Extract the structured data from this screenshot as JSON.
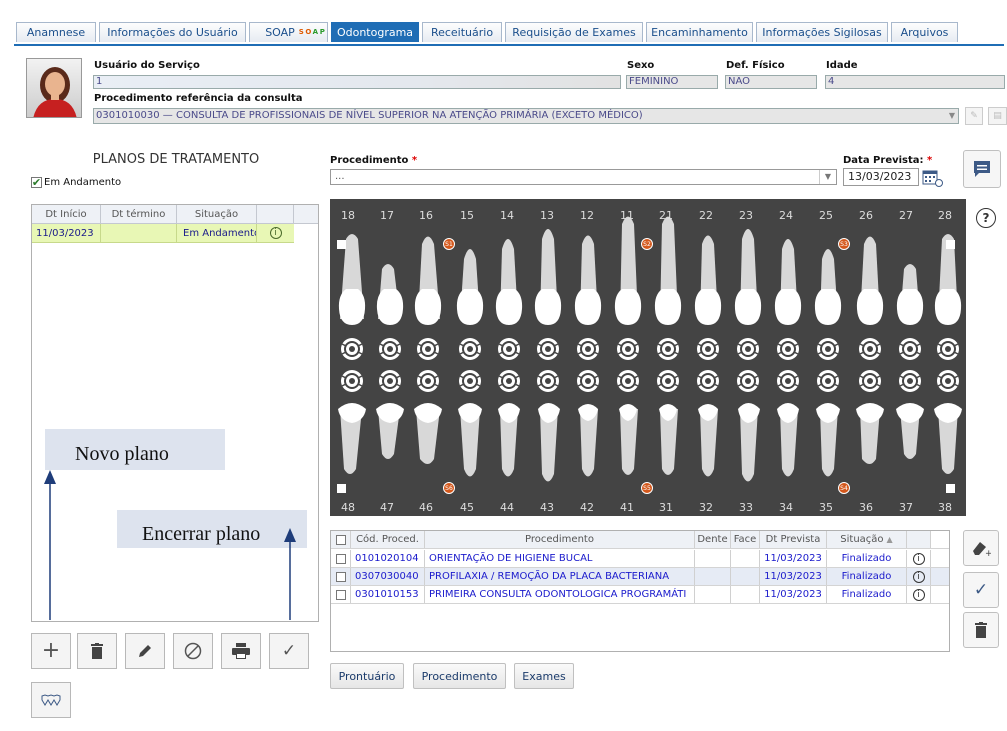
{
  "tabs": [
    {
      "label": "Anamnese"
    },
    {
      "label": "Informações do Usuário"
    },
    {
      "label": "SOAP"
    },
    {
      "label": "Odontograma"
    },
    {
      "label": "Receituário"
    },
    {
      "label": "Requisição de Exames"
    },
    {
      "label": "Encaminhamento"
    },
    {
      "label": "Informações Sigilosas"
    },
    {
      "label": "Arquivos"
    }
  ],
  "soap_badge": {
    "s": "S",
    "o": "O",
    "a": "A",
    "p": "P"
  },
  "patient": {
    "usuario_label": "Usuário do Serviço",
    "usuario_value": "1",
    "sexo_label": "Sexo",
    "sexo_value": "FEMININO",
    "deficiencia_label": "Def. Físico",
    "deficiencia_value": "NÃO",
    "idade_label": "Idade",
    "idade_value": "4",
    "procref_label": "Procedimento referência da consulta",
    "procref_value": "0301010030 — CONSULTA DE PROFISSIONAIS DE NÍVEL SUPERIOR NA ATENÇÃO PRIMÁRIA (EXCETO MÉDICO)"
  },
  "plans": {
    "title": "PLANOS DE TRATAMENTO",
    "filter_label": "Em Andamento",
    "columns": [
      "Dt Início",
      "Dt término",
      "Situação"
    ],
    "rows": [
      {
        "inicio": "11/03/2023",
        "termino": "",
        "situacao": "Em Andamento"
      }
    ]
  },
  "annotations": {
    "novo_plano": "Novo plano",
    "encerrar_plano": "Encerrar plano"
  },
  "procedure": {
    "label": "Procedimento",
    "required": "*",
    "value": "...",
    "date_label": "Data Prevista:",
    "date_value": "13/03/2023"
  },
  "odontogram": {
    "upper_teeth": [
      "18",
      "17",
      "16",
      "15",
      "14",
      "13",
      "12",
      "11",
      "21",
      "22",
      "23",
      "24",
      "25",
      "26",
      "27",
      "28"
    ],
    "lower_teeth": [
      "48",
      "47",
      "46",
      "45",
      "44",
      "43",
      "42",
      "41",
      "31",
      "32",
      "33",
      "34",
      "35",
      "36",
      "37",
      "38"
    ],
    "sextant_labels": [
      "S1",
      "S2",
      "S3",
      "S6",
      "S5",
      "S4"
    ],
    "help": "?"
  },
  "proc_table": {
    "columns": [
      "Cód. Proced.",
      "Procedimento",
      "Dente",
      "Face",
      "Dt Prevista",
      "Situação"
    ],
    "rows": [
      {
        "code": "0101020104",
        "name": "ORIENTAÇÃO DE HIGIENE BUCAL",
        "dente": "",
        "face": "",
        "date": "11/03/2023",
        "status": "Finalizado"
      },
      {
        "code": "0307030040",
        "name": "PROFILAXIA / REMOÇÃO DA PLACA BACTERIANA",
        "dente": "",
        "face": "",
        "date": "11/03/2023",
        "status": "Finalizado"
      },
      {
        "code": "0301010153",
        "name": "PRIMEIRA CONSULTA ODONTOLOGICA PROGRAMÁTI",
        "dente": "",
        "face": "",
        "date": "11/03/2023",
        "status": "Finalizado"
      }
    ]
  },
  "bottom_buttons": {
    "prontuario": "Prontuário",
    "procedimento": "Procedimento",
    "exames": "Exames"
  },
  "colors": {
    "accent": "#1f6db5",
    "plan_row": "#e8f7b5",
    "odontogram_bg": "#444444",
    "sextant_badge": "#d4581c"
  }
}
